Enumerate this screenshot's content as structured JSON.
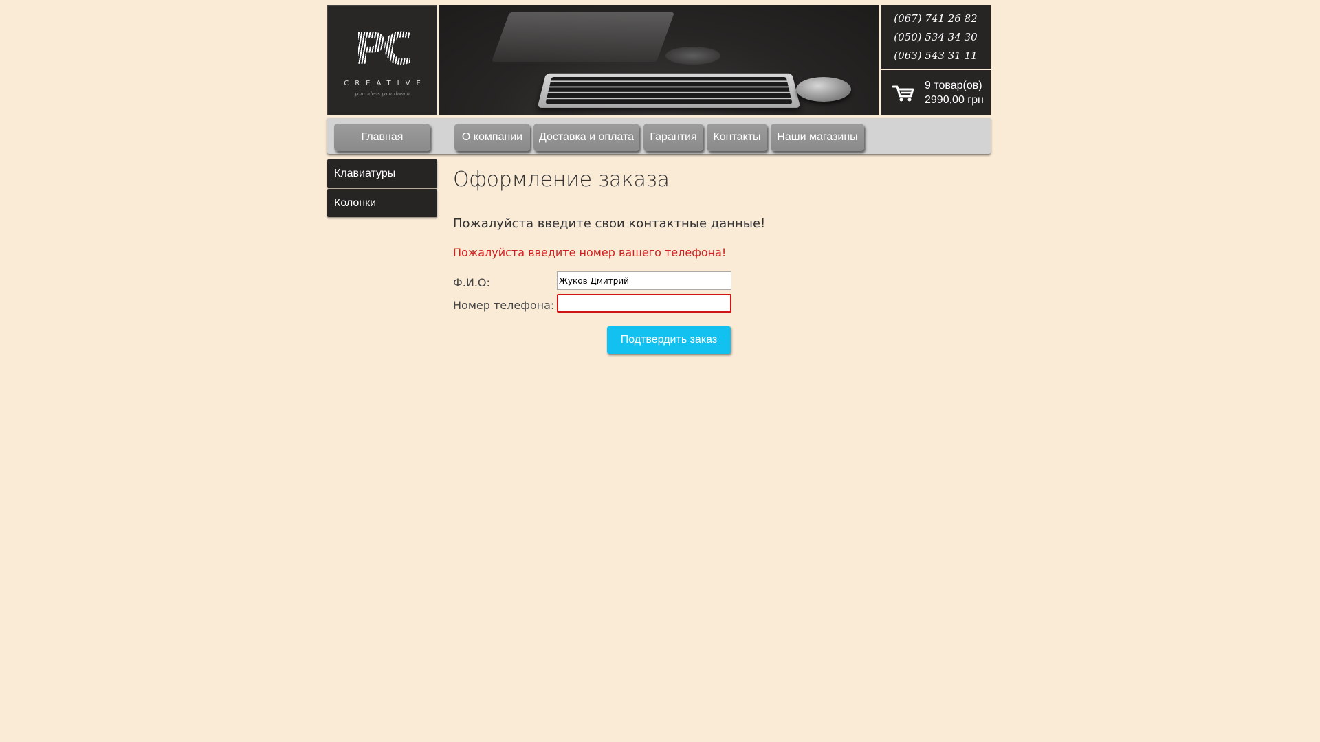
{
  "header": {
    "logo_mark": "PC",
    "logo_sub": "CREATIVE",
    "logo_script": "your ideas your dream",
    "phones": [
      "(067) 741 26 82",
      "(050) 534 34 30",
      "(063) 543 31 11"
    ],
    "cart": {
      "icon": "cart-icon",
      "count": "9 товар(ов)",
      "total": "2990,00 грн"
    }
  },
  "nav": {
    "items": [
      "Главная",
      "О компании",
      "Доставка и оплата",
      "Гарантия",
      "Контакты",
      "Наши магазины"
    ]
  },
  "sidebar": {
    "items": [
      "Клавиатуры",
      "Колонки"
    ]
  },
  "main": {
    "title": "Оформление заказа",
    "lead": "Пожалуйста введите свои контактные данные!",
    "error": "Пожалуйста введите номер вашего телефона!",
    "form": {
      "name_label": "Ф.И.О:",
      "name_value": "Жуков Дмитрий",
      "phone_label": "Номер телефона:",
      "phone_value": "",
      "submit_label": "Подтвердить заказ"
    }
  },
  "colors": {
    "background": "#faebd7",
    "dark_panel": "#262524",
    "nav_button": "#9c9c9c",
    "error": "#d22020",
    "submit": "#12c1f0"
  }
}
